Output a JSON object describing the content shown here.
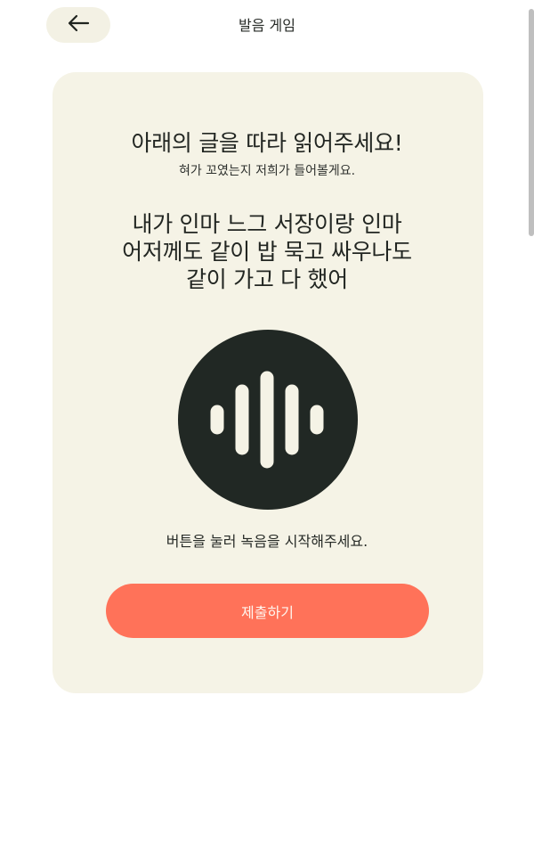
{
  "header": {
    "back_icon": "arrow-left-icon",
    "title": "발음 게임"
  },
  "card": {
    "title": "아래의 글을 따라 읽어주세요!",
    "subtitle": "혀가 꼬였는지 저희가 들어볼게요.",
    "phrase_lines": [
      "내가 인마 느그 서장이랑 인마",
      "어저께도 같이 밥 묵고 싸우나도",
      "같이 가고 다 했어"
    ],
    "record_icon": "audio-waveform-icon",
    "record_hint": "버튼을 눌러 녹음을 시작해주세요.",
    "submit_label": "제출하기"
  },
  "colors": {
    "card_bg": "#f5f3e6",
    "record_bg": "#212824",
    "submit_bg": "#ff7259",
    "back_bg": "#f3f1e4"
  }
}
